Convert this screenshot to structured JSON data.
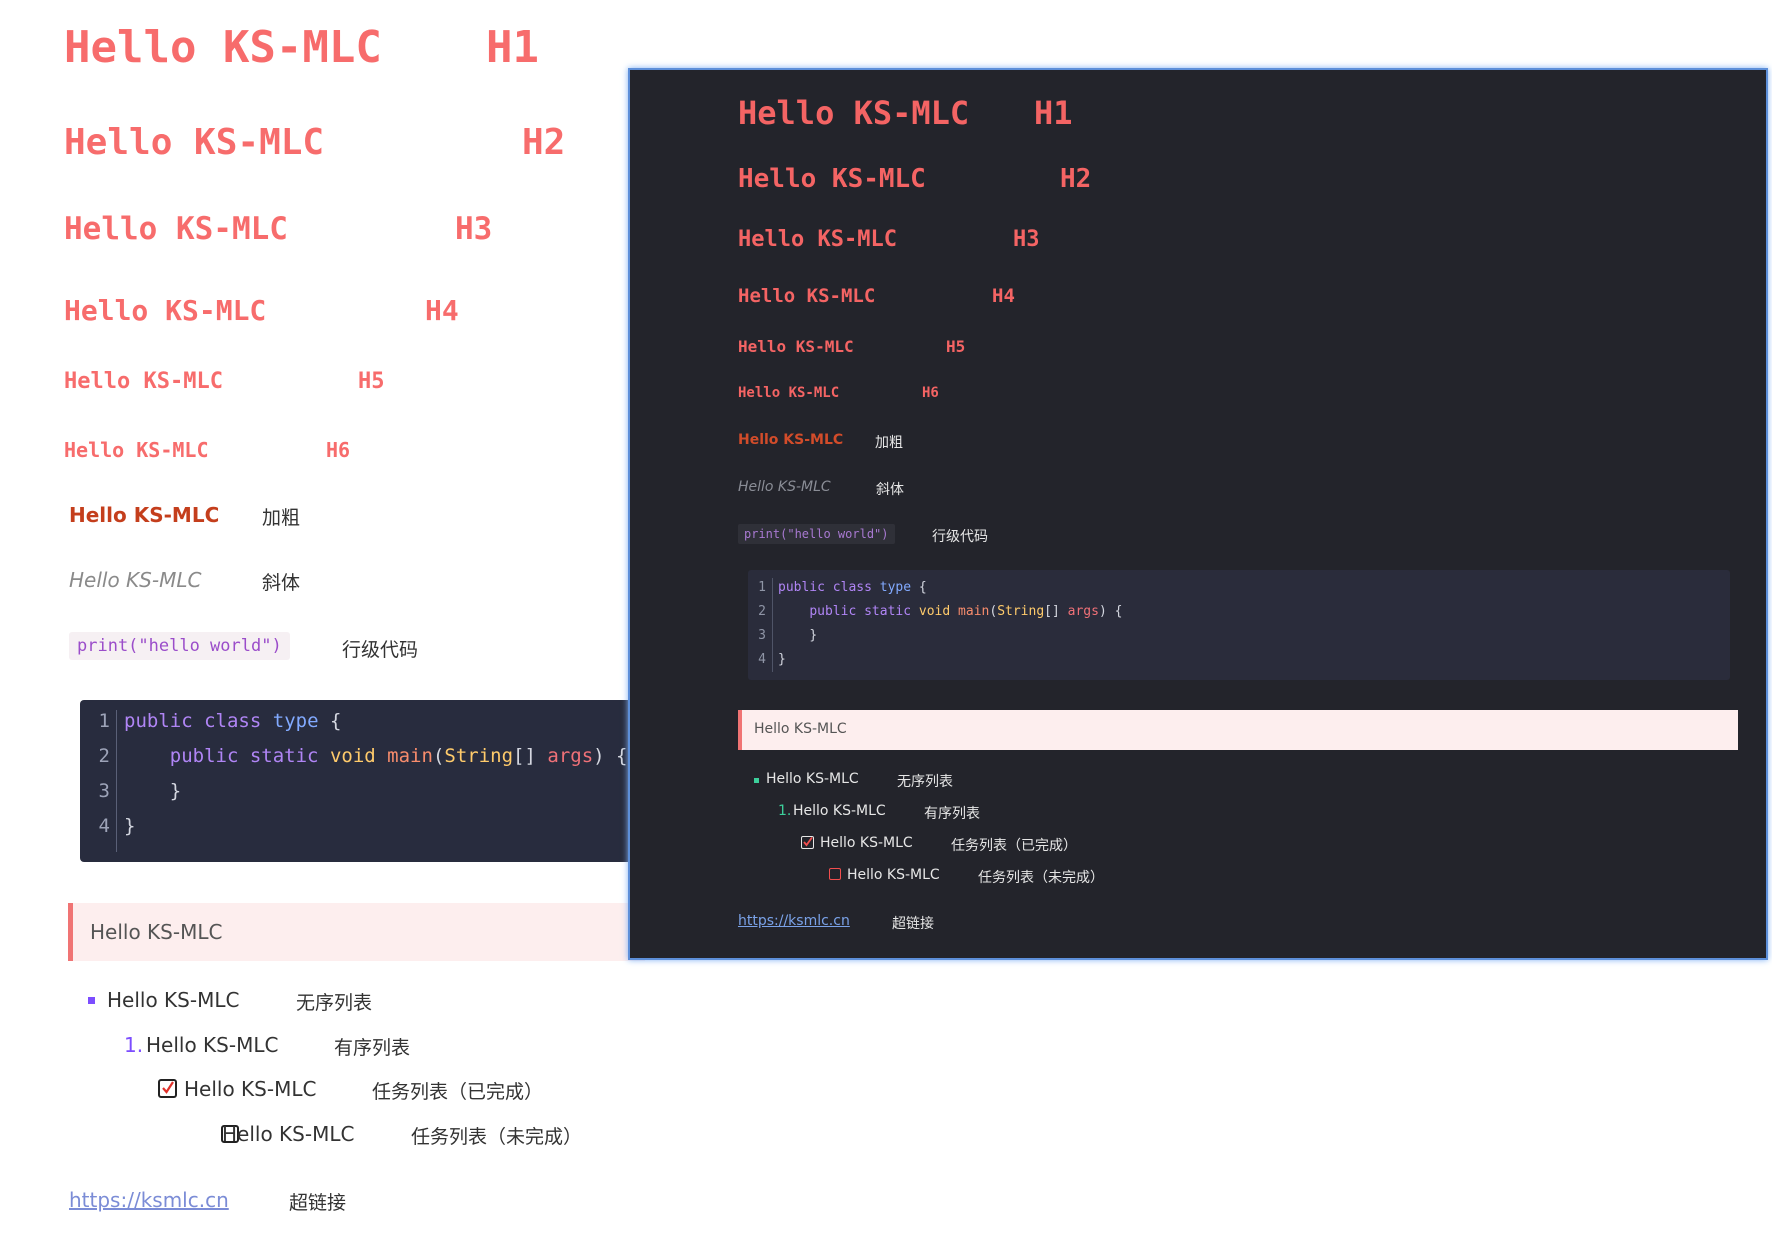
{
  "heading_text": "Hello KS-MLC",
  "headings": [
    {
      "tag": "H1"
    },
    {
      "tag": "H2"
    },
    {
      "tag": "H3"
    },
    {
      "tag": "H4"
    },
    {
      "tag": "H5"
    },
    {
      "tag": "H6"
    }
  ],
  "bold": {
    "text": "Hello KS-MLC",
    "label": "加粗"
  },
  "italic": {
    "text": "Hello KS-MLC",
    "label": "斜体"
  },
  "inline_code": {
    "text": "print(\"hello world\")",
    "label": "行级代码"
  },
  "code_block": {
    "line_numbers": [
      "1",
      "2",
      "3",
      "4"
    ],
    "lines": [
      [
        "public",
        "class",
        "type",
        "{"
      ],
      [
        "public",
        "static",
        "void",
        "main",
        "(",
        "String",
        "[]",
        "args",
        ")",
        "{"
      ],
      [
        "}"
      ],
      [
        "}"
      ]
    ]
  },
  "blockquote": {
    "text": "Hello KS-MLC"
  },
  "unordered_item": {
    "text": "Hello KS-MLC",
    "label": "无序列表"
  },
  "ordered_item": {
    "marker": "1.",
    "text": "Hello KS-MLC",
    "label": "有序列表"
  },
  "task_done": {
    "text": "Hello KS-MLC",
    "label": "任务列表（已完成）"
  },
  "task_todo": {
    "text": "Hello KS-MLC",
    "label": "任务列表（未完成）"
  },
  "link": {
    "text": "https://ksmlc.cn",
    "label": "超链接"
  },
  "colors": {
    "heading": "#f76c6c",
    "dark_background": "#23242b",
    "code_background": "#282c3e",
    "quote_background": "#fdeeee",
    "accent_list": "#7c4dff",
    "dark_accent_list": "#3ccf9b"
  }
}
